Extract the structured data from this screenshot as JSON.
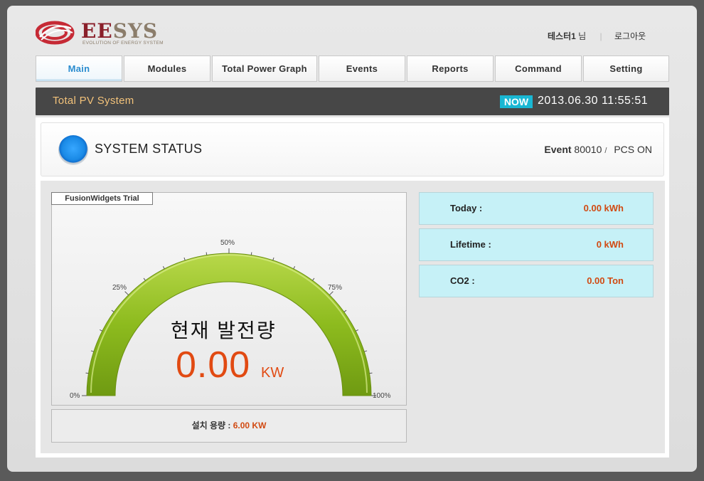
{
  "brand": {
    "name_ee": "EE",
    "name_sys": "SYS",
    "tagline": "EVOLUTION OF ENERGY SYSTEM",
    "colors": {
      "ee": "#8a1f2a",
      "sys": "#8b7d6b",
      "swirl": "#c62a35"
    }
  },
  "user": {
    "name": "테스터1",
    "suffix": "님",
    "separator": "|",
    "logout": "로그아웃"
  },
  "nav": {
    "tabs": [
      {
        "label": "Main",
        "active": true
      },
      {
        "label": "Modules"
      },
      {
        "label": "Total Power Graph"
      },
      {
        "label": "Events"
      },
      {
        "label": "Reports"
      },
      {
        "label": "Command"
      },
      {
        "label": "Setting"
      }
    ],
    "accent_color": "#2a8ccf"
  },
  "header": {
    "title": "Total PV System",
    "now_badge": "NOW",
    "datetime": "2013.06.30 11:55:51"
  },
  "system_status": {
    "title": "SYSTEM STATUS",
    "event_label": "Event",
    "event_code": "80010",
    "slash": "/",
    "pcs_status": "PCS ON",
    "indicator": "status-orb-blue"
  },
  "gauge": {
    "trial_label": "FusionWidgets Trial",
    "title": "현재 발전량",
    "value": "0.00",
    "unit": "KW",
    "percent": 0,
    "ticks": [
      "0%",
      "25%",
      "50%",
      "75%",
      "100%"
    ],
    "arc_color": "#8dbb1e"
  },
  "capacity": {
    "label": "설치 용량 :",
    "value": "6.00 KW"
  },
  "stats": [
    {
      "label": "Today :",
      "value": "0.00 kWh"
    },
    {
      "label": "Lifetime :",
      "value": "0 kWh"
    },
    {
      "label": "CO2 :",
      "value": "0.00 Ton"
    }
  ]
}
